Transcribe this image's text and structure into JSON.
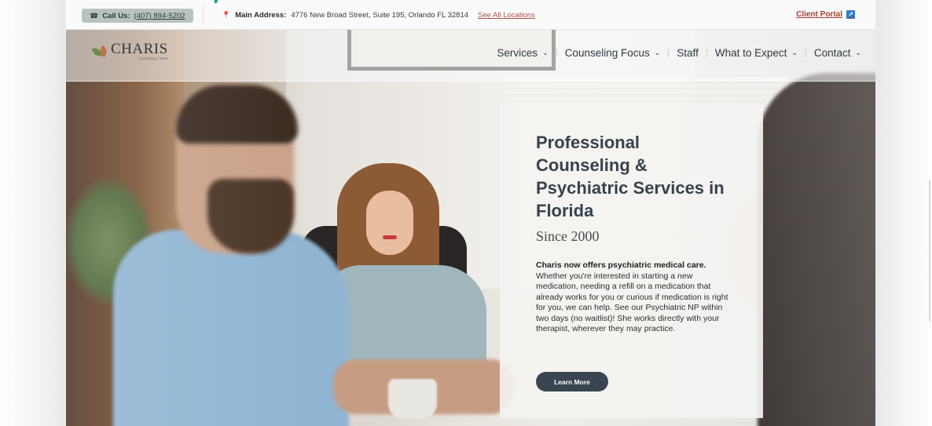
{
  "topbar": {
    "call_label": "Call Us:",
    "phone": "(407) 894-5202",
    "address_label": "Main Address:",
    "address": "4776 New Broad Street, Suite 195, Orlando FL 32814",
    "see_all": "See All Locations",
    "client_portal": "Client Portal"
  },
  "header": {
    "logo_name": "CHARIS",
    "logo_sub": "Counseling Center",
    "nav": [
      {
        "label": "Services"
      },
      {
        "label": "Counseling Focus"
      },
      {
        "label": "Staff"
      },
      {
        "label": "What to Expect"
      },
      {
        "label": "Contact"
      }
    ]
  },
  "hero": {
    "title": "Professional Counseling & Psychiatric Services in Florida",
    "since": "Since 2000",
    "body_bold": "Charis now offers psychiatric medical care.",
    "body": "Whether you're interested in starting a new medication, needing a refill on a medication that already works for you or curious if medication is right for you, we can help. See our Psychiatric NP within two days (no waitlist)! She works directly with your therapist, wherever they may practice.",
    "cta": "Learn More"
  },
  "colors": {
    "primary_dark": "#3a4551",
    "call_pill": "#b9c3bd",
    "link_red": "#a8402f",
    "portal_icon": "#2c7fd0"
  }
}
